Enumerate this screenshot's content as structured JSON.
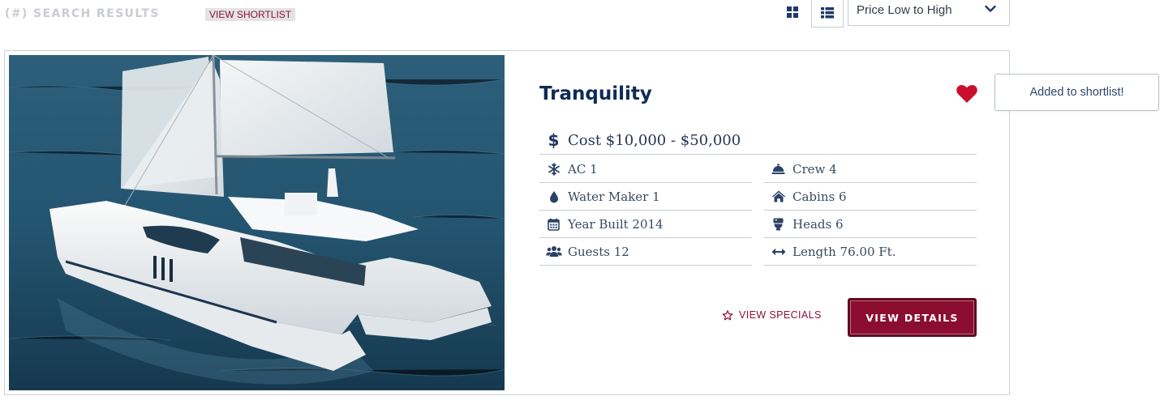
{
  "header": {
    "results_label": "(#) SEARCH RESULTS",
    "shortlist_label": "VIEW SHORTLIST",
    "view_grid_icon": "grid-view-icon",
    "view_list_icon": "list-view-icon",
    "sort": {
      "selected": "Price Low to High",
      "icon": "chevron-down-icon"
    }
  },
  "listing": {
    "name": "Tranquility",
    "favorite_icon": "heart-icon",
    "favorite_color": "#c8102e",
    "cost": "Cost $10,000 - $50,000",
    "specs_left": [
      {
        "icon": "snowflake-icon",
        "text": "AC 1"
      },
      {
        "icon": "water-drop-icon",
        "text": "Water Maker 1"
      },
      {
        "icon": "calendar-icon",
        "text": "Year Built 2014"
      },
      {
        "icon": "guests-icon",
        "text": "Guests 12"
      }
    ],
    "specs_right": [
      {
        "icon": "service-bell-icon",
        "text": "Crew 4"
      },
      {
        "icon": "home-icon",
        "text": "Cabins 6"
      },
      {
        "icon": "toilet-icon",
        "text": "Heads 6"
      },
      {
        "icon": "arrows-horizontal-icon",
        "text": "Length 76.00 Ft."
      }
    ],
    "specials_label": "VIEW SPECIALS",
    "specials_icon": "star-outline-icon",
    "details_label": "VIEW DETAILS",
    "accent_color": "#8b0e30"
  },
  "toast": {
    "message": "Added to shortlist!"
  }
}
